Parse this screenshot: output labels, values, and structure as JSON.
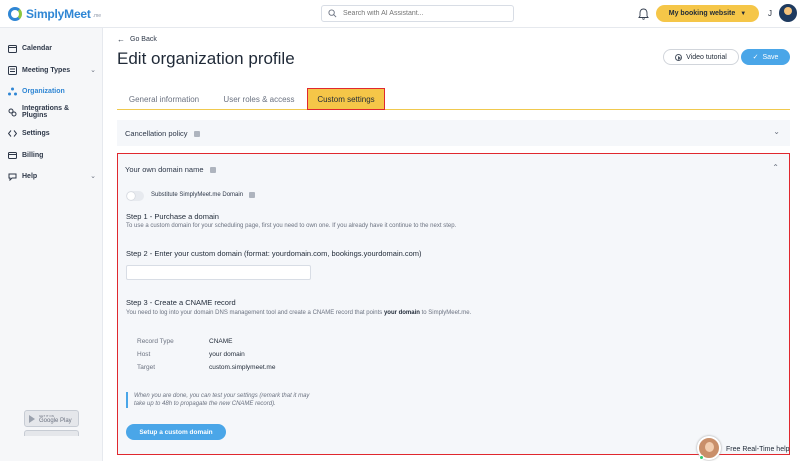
{
  "app": {
    "logo_text": "SimplyMeet",
    "logo_sub": ".me"
  },
  "topbar": {
    "search_placeholder": "Search with AI Assistant...",
    "booking_button": "My booking website",
    "user_initial": "J"
  },
  "sidebar": {
    "items": [
      {
        "label": "Calendar",
        "icon": "calendar-icon"
      },
      {
        "label": "Meeting Types",
        "icon": "meeting-types-icon",
        "expandable": true
      },
      {
        "label": "Organization",
        "icon": "organization-icon",
        "active": true
      },
      {
        "label": "Integrations & Plugins",
        "icon": "plugin-icon"
      },
      {
        "label": "Settings",
        "icon": "code-icon"
      },
      {
        "label": "Billing",
        "icon": "billing-icon"
      },
      {
        "label": "Help",
        "icon": "help-icon",
        "expandable": true
      }
    ],
    "store_badge_small": "GET IT ON",
    "store_badge_big": "Google Play"
  },
  "main": {
    "back_label": "Go Back",
    "title": "Edit organization profile",
    "video_button": "Video tutorial",
    "save_button": "Save",
    "tabs": [
      {
        "label": "General information"
      },
      {
        "label": "User roles & access"
      },
      {
        "label": "Custom settings",
        "active": true
      }
    ],
    "cancellation_panel": {
      "title": "Cancellation policy"
    },
    "domain_panel": {
      "title": "Your own domain name",
      "toggle_label": "Substitute SimplyMeet.me Domain",
      "toggle_on": false,
      "step1_title": "Step 1 - Purchase a domain",
      "step1_desc": "To use a custom domain for your scheduling page, first you need to own one. If you already have it continue to the next step.",
      "step2_title": "Step 2 - Enter your custom domain (format: yourdomain.com, bookings.yourdomain.com)",
      "step2_value": "",
      "step3_title": "Step 3 - Create a CNAME record",
      "step3_desc_pre": "You need to log into your domain DNS management tool and create a CNAME record that points ",
      "step3_desc_bold": "your domain",
      "step3_desc_post": " to SimplyMeet.me.",
      "records": [
        {
          "key": "Record Type",
          "value": "CNAME"
        },
        {
          "key": "Host",
          "value": "your domain"
        },
        {
          "key": "Target",
          "value": "custom.simplymeet.me"
        }
      ],
      "note_line1": "When you are done, you can test your settings (remark that it may",
      "note_line2": "take up to 48h to propagate the new CNAME record).",
      "setup_button": "Setup a custom domain"
    }
  },
  "chat": {
    "label": "Free Real-Time help"
  },
  "colors": {
    "accent_blue": "#4aa6e8",
    "accent_yellow": "#f5c648",
    "highlight_red": "#e0282e"
  }
}
